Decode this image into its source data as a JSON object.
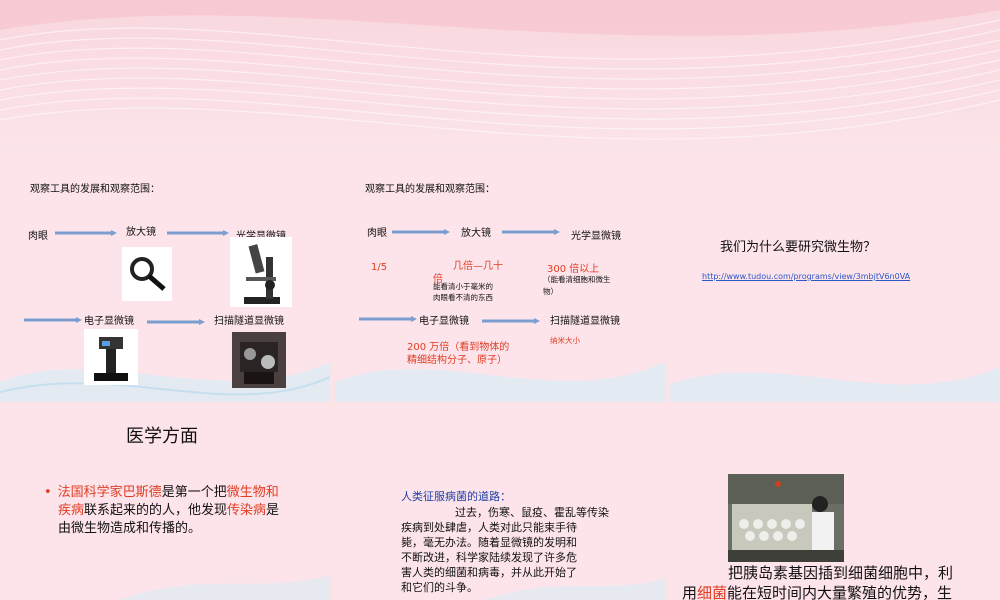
{
  "slide1": {
    "title": "观察工具的发展和观察范围：",
    "naked_eye": "肉眼",
    "magnifier": "放大镜",
    "optical_microscope": "光学显微镜",
    "electron_microscope": "电子显微镜",
    "stm": "扫描隧道显微镜"
  },
  "slide2": {
    "title": "观察工具的发展和观察范围：",
    "naked_eye": "肉眼",
    "magnifier": "放大镜",
    "optical_microscope": "光学显微镜",
    "electron_microscope": "电子显微镜",
    "stm": "扫描隧道显微镜",
    "ratio": "1/5",
    "magnifier_power_a": "几倍—几十",
    "magnifier_power_b": "倍",
    "magnifier_note_a": "能看清小于毫米的",
    "magnifier_note_b": "肉眼看不清的东西",
    "optical_power": "300 倍以上",
    "optical_note_a": "（能看清细胞和微生",
    "optical_note_b": "物）",
    "electron_power_a": "200 万倍（看到物体的",
    "electron_power_b": "精细结构分子、原子）",
    "stm_note": "纳米大小"
  },
  "slide3": {
    "question": "我们为什么要研究微生物？",
    "link": "http://www.tudou.com/programs/view/3mbjtV6n0VA"
  },
  "slide4": {
    "heading": "医学方面",
    "bullet": "•",
    "p1": "法国科学家巴斯德",
    "p2": "是第一个把",
    "p3": "微生物和",
    "p4": "疾病",
    "p5": "联系起来的的人，他发现",
    "p6": "传染病",
    "p7": "是",
    "p8": "由微生物造成和传播的。"
  },
  "slide5": {
    "title": "人类征服病菌的道路：",
    "l1": "过去，伤寒、鼠疫、霍乱等传染",
    "l2": "疾病到处肆虐，人类对此只能束手待",
    "l3": "毙，毫无办法。随着显微镜的发明和",
    "l4": "不断改进，科学家陆续发现了许多危",
    "l5": "害人类的细菌和病毒，并从此开始了",
    "l6": "和它们的斗争。"
  },
  "slide6": {
    "l1": "把胰岛素基因插到细菌细胞中，利",
    "l2a": "用",
    "l2b": "细菌",
    "l2c": "能在短时间内大量繁殖的优势，生"
  },
  "colors": {
    "accent_red": "#e03c22",
    "link_blue": "#2b57c7",
    "title_blue": "#1f3fa6"
  }
}
